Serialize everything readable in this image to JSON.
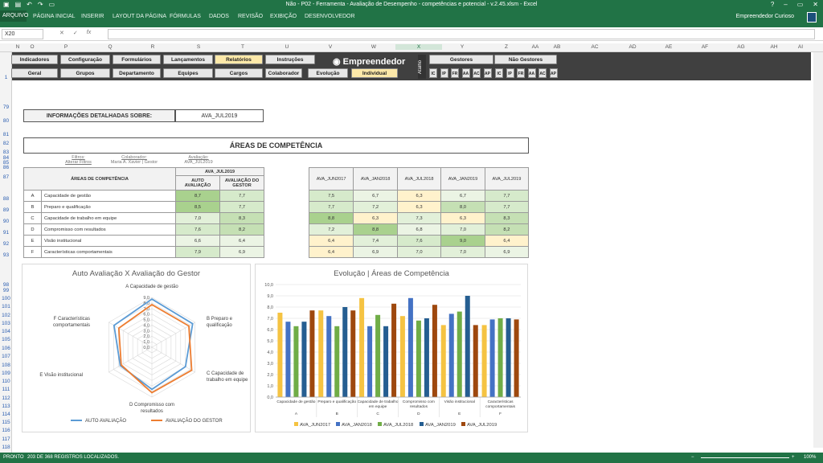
{
  "window": {
    "title": "Não - P02 - Ferramenta - Avaliação de Desempenho - competências e potencial - v.2.45.xlsm - Excel",
    "help": "?",
    "minimize": "–",
    "restore": "▭",
    "close": "✕"
  },
  "ribbon": {
    "file": "ARQUIVO",
    "tabs": [
      "PÁGINA INICIAL",
      "INSERIR",
      "LAYOUT DA PÁGINA",
      "FÓRMULAS",
      "DADOS",
      "REVISÃO",
      "EXIBIÇÃO",
      "DESENVOLVEDOR"
    ],
    "user": "Empreendedor Curioso"
  },
  "formula_bar": {
    "name_box": "X20",
    "cancel": "✕",
    "enter": "✓",
    "fx": "fx",
    "value": ""
  },
  "columns": [
    "N",
    "O",
    "P",
    "Q",
    "R",
    "S",
    "T",
    "U",
    "V",
    "W",
    "X",
    "Y",
    "Z",
    "AA",
    "AB",
    "AC",
    "AD",
    "AE",
    "AF",
    "AG",
    "AH",
    "AI"
  ],
  "rows": [
    "1",
    "79",
    "80",
    "81",
    "82",
    "83",
    "84",
    "85",
    "86",
    "87",
    "88",
    "89",
    "90",
    "91",
    "92",
    "93",
    "98",
    "99",
    "100",
    "101",
    "102",
    "103",
    "104",
    "105",
    "106",
    "107",
    "108",
    "109",
    "110",
    "111",
    "112",
    "113",
    "114",
    "115",
    "116",
    "117",
    "118"
  ],
  "menu": {
    "row1": [
      "Indicadores",
      "Configuração",
      "Formulários",
      "Lançamentos",
      "Relatórios",
      "Instruções"
    ],
    "row2": [
      "Geral",
      "Grupos",
      "Departamento",
      "Equipes",
      "Cargos",
      "Colaborador",
      "Evolução",
      "Individual"
    ],
    "logo": "Empreendedor",
    "atalho": "Atalho",
    "gestores": "Gestores",
    "nao_gestores": "Não Gestores",
    "codes": [
      "IC",
      "IP",
      "FR",
      "AA",
      "AC",
      "AP"
    ]
  },
  "info": {
    "label": "INFORMAÇÕES DETALHADAS SOBRE:",
    "value": "AVA_JUL2019"
  },
  "section_title": "ÁREAS DE COMPETÊNCIA",
  "filters": {
    "f1": "Filtros:",
    "f1v": "Alterar Filtros",
    "f2": "Colaborador:",
    "f2v": "Maria A. Xavier | Gestor",
    "f3": "Avaliação:",
    "f3v": "AVA_JUL2019"
  },
  "table1": {
    "col_area": "ÁREAS DE COMPETÊNCIA",
    "period": "AVA_JUL2019",
    "col_auto": "AUTO AVALIAÇÃO",
    "col_gestor": "AVALIAÇÃO DO GESTOR",
    "rows": [
      {
        "k": "A",
        "n": "Capacidade de gestão",
        "a": "8,7",
        "g": "7,7"
      },
      {
        "k": "B",
        "n": "Preparo e qualificação",
        "a": "8,5",
        "g": "7,7"
      },
      {
        "k": "C",
        "n": "Capacidade de trabalho em equipe",
        "a": "7,0",
        "g": "8,3"
      },
      {
        "k": "D",
        "n": "Compromisso com resultados",
        "a": "7,6",
        "g": "8,2"
      },
      {
        "k": "E",
        "n": "Visão institucional",
        "a": "6,6",
        "g": "6,4"
      },
      {
        "k": "F",
        "n": "Características comportamentais",
        "a": "7,9",
        "g": "6,9"
      }
    ]
  },
  "table2": {
    "headers": [
      "AVA_JUN2017",
      "AVA_JAN2018",
      "AVA_JUL2018",
      "AVA_JAN2019",
      "AVA_JUL2019"
    ],
    "rows": [
      [
        "7,5",
        "6,7",
        "6,3",
        "6,7",
        "7,7"
      ],
      [
        "7,7",
        "7,2",
        "6,3",
        "8,0",
        "7,7"
      ],
      [
        "8,8",
        "6,3",
        "7,3",
        "6,3",
        "8,3"
      ],
      [
        "7,2",
        "8,8",
        "6,8",
        "7,0",
        "8,2"
      ],
      [
        "6,4",
        "7,4",
        "7,6",
        "9,0",
        "6,4"
      ],
      [
        "6,4",
        "6,9",
        "7,0",
        "7,0",
        "6,9"
      ]
    ]
  },
  "radar": {
    "title": "Auto Avaliação X Avaliação do Gestor",
    "labels": [
      "A Capacidade de gestão",
      "B Preparo e qualificação",
      "C Capacidade de trabalho em equipe",
      "D Compromisso com resultados",
      "E Visão institucional",
      "F Características comportamentais"
    ],
    "ticks": [
      "0,0",
      "1,0",
      "2,0",
      "3,0",
      "4,0",
      "5,0",
      "6,0",
      "7,0",
      "8,0",
      "9,0"
    ],
    "legend": [
      "AUTO AVALIAÇÃO",
      "AVALIAÇÃO DO GESTOR"
    ]
  },
  "bar": {
    "title": "Evolução | Áreas de Competência",
    "yticks": [
      "0,0",
      "1,0",
      "2,0",
      "3,0",
      "4,0",
      "5,0",
      "6,0",
      "7,0",
      "8,0",
      "9,0",
      "10,0"
    ],
    "cat_names": [
      "Capacidade de gestão",
      "Preparo e qualificação",
      "Capacidade de trabalho em equipe",
      "Compromisso com resultados",
      "Visão institucional",
      "Características comportamentais"
    ],
    "cat_letters": [
      "A",
      "B",
      "C",
      "D",
      "E",
      "F"
    ]
  },
  "chart_data": [
    {
      "type": "radar",
      "title": "Auto Avaliação X Avaliação do Gestor",
      "categories": [
        "A Capacidade de gestão",
        "B Preparo e qualificação",
        "C Capacidade de trabalho em equipe",
        "D Compromisso com resultados",
        "E Visão institucional",
        "F Características comportamentais"
      ],
      "ylim": [
        0,
        9
      ],
      "series": [
        {
          "name": "AUTO AVALIAÇÃO",
          "color": "#5b9bd5",
          "values": [
            8.7,
            8.5,
            7.0,
            7.6,
            6.6,
            7.9
          ]
        },
        {
          "name": "AVALIAÇÃO DO GESTOR",
          "color": "#ed7d31",
          "values": [
            7.7,
            7.7,
            8.3,
            8.2,
            6.4,
            6.9
          ]
        }
      ],
      "legend": "bottom"
    },
    {
      "type": "bar",
      "title": "Evolução | Áreas de Competência",
      "categories": [
        "A",
        "B",
        "C",
        "D",
        "E",
        "F"
      ],
      "ylim": [
        0,
        10
      ],
      "grid": true,
      "legend": "bottom",
      "series": [
        {
          "name": "AVA_JUN2017",
          "color": "#f5c342",
          "values": [
            7.5,
            7.7,
            8.8,
            7.2,
            6.4,
            6.4
          ]
        },
        {
          "name": "AVA_JAN2018",
          "color": "#4472c4",
          "values": [
            6.7,
            7.2,
            6.3,
            8.8,
            7.4,
            6.9
          ]
        },
        {
          "name": "AVA_JUL2018",
          "color": "#70ad47",
          "values": [
            6.3,
            6.3,
            7.3,
            6.8,
            7.6,
            7.0
          ]
        },
        {
          "name": "AVA_JAN2019",
          "color": "#255e91",
          "values": [
            6.7,
            8.0,
            6.3,
            7.0,
            9.0,
            7.0
          ]
        },
        {
          "name": "AVA_JUL2019",
          "color": "#9e480e",
          "values": [
            7.7,
            7.7,
            8.3,
            8.2,
            6.4,
            6.9
          ]
        }
      ]
    }
  ],
  "statusbar": {
    "ready": "PRONTO",
    "records": "203 DE 368 REGISTROS LOCALIZADOS.",
    "zoom": "100%"
  }
}
